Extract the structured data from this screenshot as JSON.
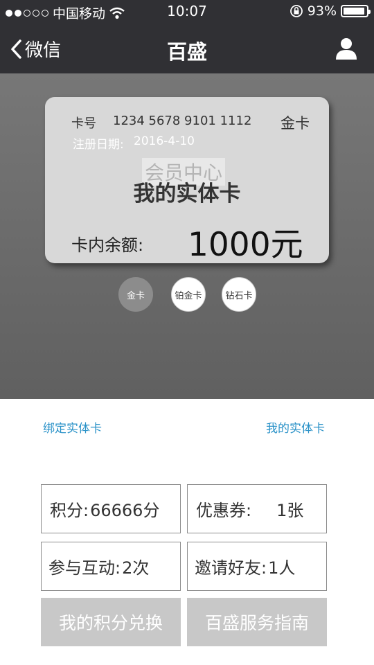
{
  "status": {
    "carrier": "中国移动",
    "time": "10:07",
    "battery": "93%",
    "battery_level": 0.93,
    "signal_strength": 2,
    "signal_max": 5
  },
  "nav": {
    "back_label": "微信",
    "title": "百盛",
    "user_icon": "user-icon"
  },
  "card": {
    "number_label": "卡号",
    "number": "1234 5678 9101 1112",
    "level": "金卡",
    "reg_label": "注册日期:",
    "reg_date": "2016-4-10",
    "watermark": "会员中心",
    "title": "我的实体卡",
    "balance_label": "卡内余额:",
    "balance": "1000元"
  },
  "levels": [
    {
      "label": "金卡",
      "active": true
    },
    {
      "label": "铂金卡",
      "active": false
    },
    {
      "label": "钻石卡",
      "active": false
    }
  ],
  "links": {
    "bind": "绑定实体卡",
    "my_card": "我的实体卡"
  },
  "stats": {
    "points": {
      "label": "积分:",
      "value": "66666分"
    },
    "coupons": {
      "label": "优惠券:",
      "value": "1张"
    },
    "interactions": {
      "label": "参与互动:",
      "value": "2次"
    },
    "invites": {
      "label": "邀请好友:",
      "value": "1人"
    }
  },
  "actions": {
    "exchange": "我的积分兑换",
    "guide": "百盛服务指南"
  },
  "colors": {
    "bar": "#303034",
    "link": "#2a92c8",
    "button": "#c8c8c8"
  }
}
